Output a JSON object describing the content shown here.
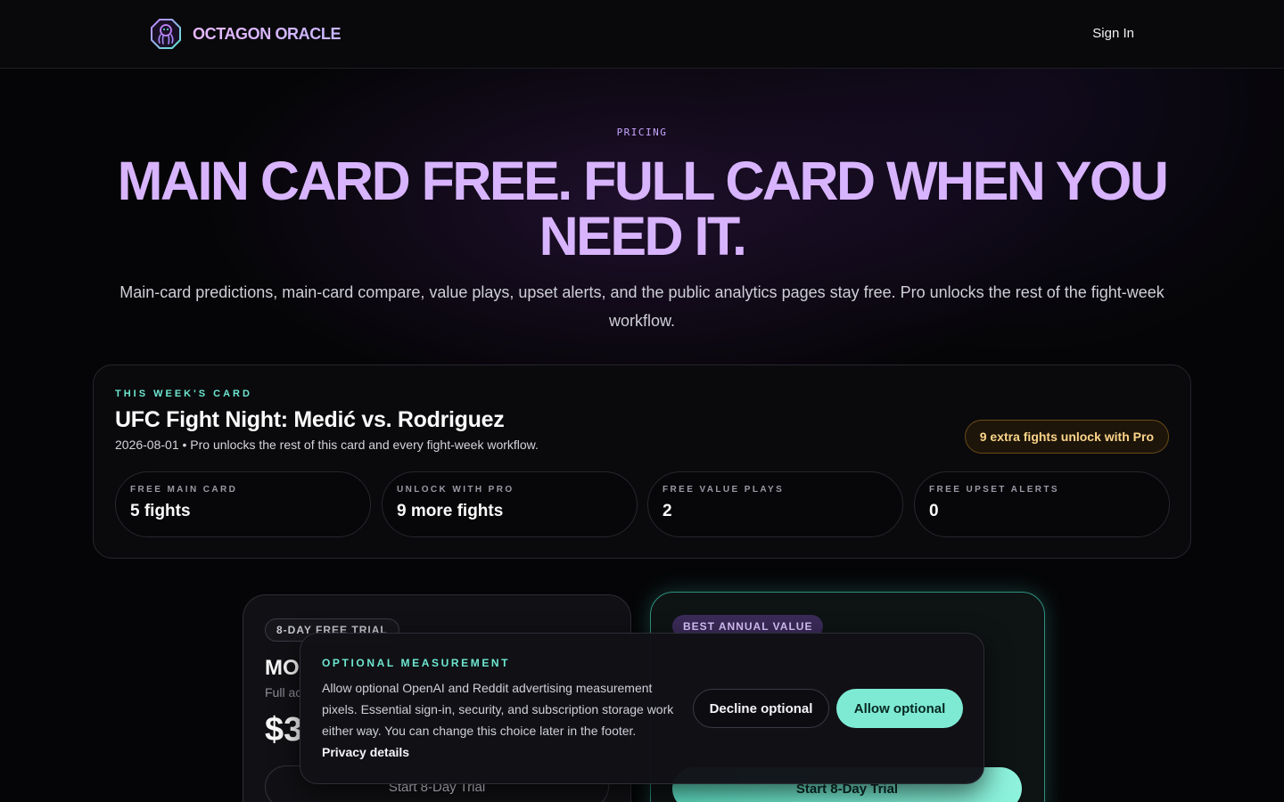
{
  "header": {
    "brand": "OCTAGON ORACLE",
    "sign_in": "Sign In"
  },
  "hero": {
    "eyebrow": "PRICING",
    "title": "MAIN CARD FREE. FULL CARD WHEN YOU NEED IT.",
    "subtitle": "Main-card predictions, main-card compare, value plays, upset alerts, and the public analytics pages stay free. Pro unlocks the rest of the fight-week workflow."
  },
  "week_card": {
    "eyebrow": "THIS WEEK'S CARD",
    "event_title": "UFC Fight Night: Medić vs. Rodriguez",
    "meta": "2026-08-01 • Pro unlocks the rest of this card and every fight-week workflow.",
    "pro_pill": "9 extra fights unlock with Pro",
    "stats": [
      {
        "label": "FREE MAIN CARD",
        "value": "5 fights"
      },
      {
        "label": "UNLOCK WITH PRO",
        "value": "9 more fights"
      },
      {
        "label": "FREE VALUE PLAYS",
        "value": "2"
      },
      {
        "label": "FREE UPSET ALERTS",
        "value": "0"
      }
    ]
  },
  "plans": {
    "monthly": {
      "badge": "8-DAY FREE TRIAL",
      "name_visible": "MO",
      "desc_visible": "Full ac",
      "price_visible": "$3",
      "button": "Start 8-Day Trial"
    },
    "annual": {
      "badge": "BEST ANNUAL VALUE",
      "button": "Start 8-Day Trial"
    }
  },
  "consent": {
    "eyebrow": "OPTIONAL MEASUREMENT",
    "text": "Allow optional OpenAI and Reddit advertising measurement pixels. Essential sign-in, security, and subscription storage work either way. You can change this choice later in the footer.",
    "link": "Privacy details",
    "decline": "Decline optional",
    "allow": "Allow optional"
  },
  "colors": {
    "accent_purple": "#d8b4fe",
    "accent_teal": "#7eead4",
    "pro_amber": "#fcd58a"
  }
}
